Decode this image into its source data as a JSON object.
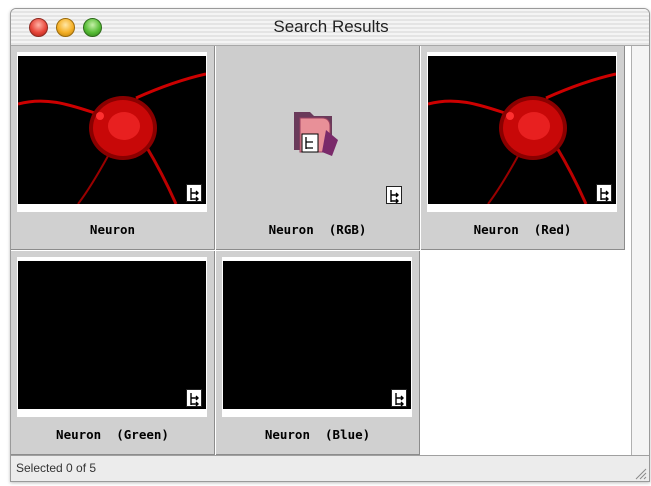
{
  "window": {
    "title": "Search Results"
  },
  "results": [
    {
      "label": "Neuron",
      "kind": "neuron-red-image"
    },
    {
      "label": "Neuron  (RGB)",
      "kind": "folder-icon"
    },
    {
      "label": "Neuron  (Red)",
      "kind": "neuron-red-image"
    },
    {
      "label": "Neuron  (Green)",
      "kind": "black-image"
    },
    {
      "label": "Neuron  (Blue)",
      "kind": "black-image"
    }
  ],
  "status": {
    "text": "Selected 0 of 5"
  },
  "colors": {
    "neuron": "#e01010",
    "background": "#000000",
    "cell": "#d0d0d0"
  }
}
